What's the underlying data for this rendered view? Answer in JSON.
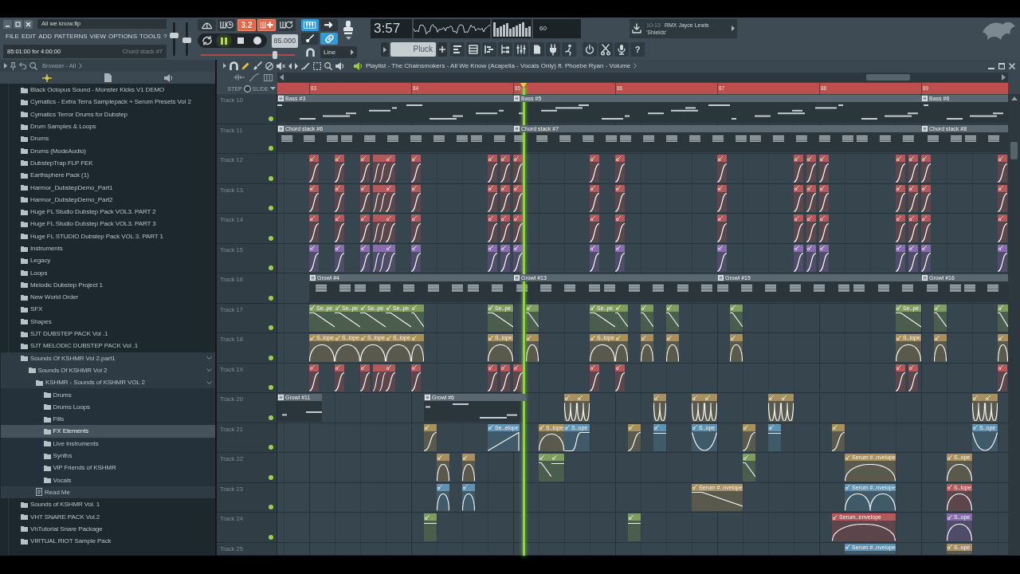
{
  "window": {
    "title": "All we know.flp",
    "menu": [
      "FILE",
      "EDIT",
      "ADD",
      "PATTERNS",
      "VIEW",
      "OPTIONS",
      "TOOLS",
      "?"
    ]
  },
  "hint_bar": {
    "position": "85:01:00 for 4:00:00",
    "clip": "Chord stack #7"
  },
  "master_sliders": [
    {
      "level": 0.62
    },
    {
      "level": 0.45
    }
  ],
  "transport": {
    "toggles": [
      {
        "kind": "metronome",
        "on": false
      },
      {
        "kind": "wait",
        "on": false
      },
      {
        "kind": "countdown",
        "label": "3.2",
        "on": true
      },
      {
        "kind": "step_edit",
        "on": true
      },
      {
        "kind": "loop_record",
        "on": false
      }
    ],
    "playing": true,
    "recording": false,
    "tempo": "85.000",
    "pitch": {
      "level": 0.8
    }
  },
  "snap": {
    "toggles": [
      {
        "kind": "keyboard",
        "on": true
      },
      {
        "kind": "arrow",
        "on": false
      },
      {
        "kind": "pen",
        "on": false
      },
      {
        "kind": "link",
        "on": true
      }
    ],
    "value": "Line"
  },
  "monitor": {
    "time": "3:57",
    "cpu": "60"
  },
  "pattern": {
    "name": "Pluck"
  },
  "help": "?",
  "hint_panel": {
    "tag": "10-13",
    "lines": [
      "RMX Jayce Lewis",
      "'Shields'"
    ]
  },
  "browser": {
    "title": "Browser - All",
    "items": [
      {
        "label": "Black Octopus Sound - Monster Kicks V1 DEMO",
        "kind": "folder",
        "expanded": false,
        "selected": false
      },
      {
        "label": "Cymatics - Extra Terra Samplepack + Serum Presets Vol 2",
        "kind": "folder",
        "expanded": false,
        "selected": false
      },
      {
        "label": "Cymatics Terror Drums for Dubstep",
        "kind": "folder",
        "expanded": false,
        "selected": false
      },
      {
        "label": "Drum Samples & Loops",
        "kind": "folder",
        "expanded": false,
        "selected": false
      },
      {
        "label": "Drums",
        "kind": "folder",
        "expanded": false,
        "selected": false
      },
      {
        "label": "Drums (ModeAudio)",
        "kind": "folder",
        "expanded": false,
        "selected": false
      },
      {
        "label": "DubstepTrap FLP FEK",
        "kind": "folder",
        "expanded": false,
        "selected": false
      },
      {
        "label": "Earthsphere Pack (1)",
        "kind": "folder",
        "expanded": false,
        "selected": false
      },
      {
        "label": "Harmor_DubstepDemo_Part1",
        "kind": "folder",
        "expanded": false,
        "selected": false
      },
      {
        "label": "Harmor_DubstepDemo_Part2",
        "kind": "folder",
        "expanded": false,
        "selected": false
      },
      {
        "label": "Huge FL Studio Dubstep Pack VOL3. PART 2",
        "kind": "folder",
        "expanded": false,
        "selected": false
      },
      {
        "label": "Huge FL Studio Dubstep Pack VOL3. PART 3",
        "kind": "folder",
        "expanded": false,
        "selected": false
      },
      {
        "label": "Huge FL STUDIO Dubstep Pack VOL 3. PART 1",
        "kind": "folder",
        "expanded": false,
        "selected": false
      },
      {
        "label": "Instruments",
        "kind": "folder",
        "expanded": false,
        "selected": false
      },
      {
        "label": "Legacy",
        "kind": "folder",
        "expanded": false,
        "selected": false
      },
      {
        "label": "Loops",
        "kind": "folder",
        "expanded": false,
        "selected": false
      },
      {
        "label": "Melodic Dubstep Project 1",
        "kind": "folder",
        "expanded": false,
        "selected": false
      },
      {
        "label": "New World Order",
        "kind": "folder",
        "expanded": false,
        "selected": false
      },
      {
        "label": "SFX",
        "kind": "folder",
        "expanded": false,
        "selected": false
      },
      {
        "label": "Shapes",
        "kind": "folder",
        "expanded": false,
        "selected": false
      },
      {
        "label": "SJT DUBSTEP PACK Vol .1",
        "kind": "folder",
        "expanded": false,
        "selected": false
      },
      {
        "label": "SJT MELODIC DUBSTEP PACK Vol .1",
        "kind": "folder",
        "expanded": false,
        "selected": false
      },
      {
        "label": "Sounds Of KSHMR Vol 2.part1",
        "kind": "folder",
        "expanded": true,
        "selected": false,
        "children": [
          {
            "label": "Sounds Of KSHMR Vol 2",
            "kind": "folder",
            "expanded": true,
            "selected": false,
            "children": [
              {
                "label": "KSHMR - Sounds of KSHMR VOL 2",
                "kind": "folder",
                "expanded": true,
                "selected": false,
                "children": [
                  {
                    "label": "Drums",
                    "kind": "folder",
                    "expanded": false,
                    "selected": false
                  },
                  {
                    "label": "Drums Loops",
                    "kind": "folder",
                    "expanded": false,
                    "selected": false
                  },
                  {
                    "label": "Fills",
                    "kind": "folder",
                    "expanded": false,
                    "selected": false
                  },
                  {
                    "label": "FX Elements",
                    "kind": "folder",
                    "expanded": false,
                    "selected": true
                  },
                  {
                    "label": "Live Instruments",
                    "kind": "folder",
                    "expanded": false,
                    "selected": false
                  },
                  {
                    "label": "Synths",
                    "kind": "folder",
                    "expanded": false,
                    "selected": false
                  },
                  {
                    "label": "ViP Friends of KSHMR",
                    "kind": "folder",
                    "expanded": false,
                    "selected": false
                  },
                  {
                    "label": "Vocals",
                    "kind": "folder",
                    "expanded": false,
                    "selected": false
                  }
                ]
              },
              {
                "label": "Read Me",
                "kind": "file",
                "expanded": false,
                "selected": false
              }
            ]
          }
        ]
      },
      {
        "label": "Sounds of KSHMR Vol. 1",
        "kind": "folder",
        "expanded": false,
        "selected": false
      },
      {
        "label": "VHT SNARE PACK Vol.2",
        "kind": "folder",
        "expanded": false,
        "selected": false
      },
      {
        "label": "VhTutorial Snare Package",
        "kind": "folder",
        "expanded": false,
        "selected": false
      },
      {
        "label": "VIRTUAL RIOT Sample Pack",
        "kind": "folder",
        "expanded": false,
        "selected": false
      }
    ]
  },
  "playlist": {
    "title": "Playlist - The Chainsmokers - All We Know (Acapella - Vocals Only) ft. Phoebe Ryan - Volume",
    "modes": [
      "STEP",
      "SLIDE"
    ],
    "ruler": [
      "83",
      "84",
      "85",
      "86",
      "87",
      "88",
      "89"
    ],
    "tracks": [
      {
        "label": "Track 10",
        "enabled": true,
        "clips": [
          {
            "kind": "pattern",
            "label": "Bass #3",
            "color": "#5a6770"
          },
          {
            "kind": "pattern",
            "label": "Bass #5",
            "color": "#5a6770"
          },
          {
            "kind": "pattern",
            "label": "Bass #6",
            "color": "#5a6770"
          }
        ]
      },
      {
        "label": "Track 11",
        "enabled": true,
        "clips": [
          {
            "kind": "pattern",
            "label": "Chord stack #6",
            "color": "#5a6770"
          },
          {
            "kind": "pattern",
            "label": "Chord stack #7",
            "color": "#5a6770"
          },
          {
            "kind": "pattern",
            "label": "Chord stack #8",
            "color": "#5a6770"
          }
        ]
      },
      {
        "label": "Track 12",
        "enabled": true,
        "clips": [
          {
            "kind": "rise",
            "color": "#b4585a"
          },
          {
            "kind": "rise",
            "color": "#b4585a"
          },
          {
            "kind": "rise",
            "color": "#b4585a"
          },
          {
            "kind": "rise",
            "color": "#b4585a"
          },
          {
            "kind": "rise",
            "color": "#b4585a"
          },
          {
            "kind": "rise",
            "color": "#b4585a"
          },
          {
            "kind": "rise",
            "color": "#b4585a"
          },
          {
            "kind": "rise",
            "color": "#b4585a"
          },
          {
            "kind": "rise",
            "color": "#b4585a"
          },
          {
            "kind": "rise",
            "color": "#b4585a"
          },
          {
            "kind": "rise",
            "color": "#b4585a"
          },
          {
            "kind": "rise",
            "color": "#b4585a"
          },
          {
            "kind": "rise",
            "color": "#b4585a"
          },
          {
            "kind": "rise",
            "color": "#b4585a"
          },
          {
            "kind": "rise",
            "color": "#b4585a"
          },
          {
            "kind": "rise",
            "color": "#b4585a"
          },
          {
            "kind": "rise",
            "color": "#b4585a"
          },
          {
            "kind": "rise",
            "color": "#b4585a"
          },
          {
            "kind": "rise",
            "color": "#b4585a"
          },
          {
            "kind": "rise",
            "color": "#b4585a"
          }
        ]
      },
      {
        "label": "Track 13",
        "enabled": true,
        "clips": [
          {
            "kind": "rise",
            "color": "#b4585a"
          },
          {
            "kind": "rise",
            "color": "#b4585a"
          },
          {
            "kind": "rise",
            "color": "#b4585a"
          },
          {
            "kind": "rise",
            "color": "#b4585a"
          },
          {
            "kind": "rise",
            "color": "#b4585a"
          },
          {
            "kind": "rise",
            "color": "#b4585a"
          },
          {
            "kind": "rise",
            "color": "#b4585a"
          },
          {
            "kind": "rise",
            "color": "#b4585a"
          },
          {
            "kind": "rise",
            "color": "#b4585a"
          },
          {
            "kind": "rise",
            "color": "#b4585a"
          },
          {
            "kind": "rise",
            "color": "#b4585a"
          },
          {
            "kind": "rise",
            "color": "#b4585a"
          },
          {
            "kind": "rise",
            "color": "#b4585a"
          },
          {
            "kind": "rise",
            "color": "#b4585a"
          },
          {
            "kind": "rise",
            "color": "#b4585a"
          },
          {
            "kind": "rise",
            "color": "#b4585a"
          },
          {
            "kind": "rise",
            "color": "#b4585a"
          },
          {
            "kind": "rise",
            "color": "#b4585a"
          },
          {
            "kind": "rise",
            "color": "#b4585a"
          },
          {
            "kind": "rise",
            "color": "#b4585a"
          }
        ]
      },
      {
        "label": "Track 14",
        "enabled": true,
        "clips": [
          {
            "kind": "rise",
            "color": "#b4585a"
          },
          {
            "kind": "rise",
            "color": "#b4585a"
          },
          {
            "kind": "rise",
            "color": "#b4585a"
          },
          {
            "kind": "rise",
            "color": "#b4585a"
          },
          {
            "kind": "rise",
            "color": "#b4585a"
          },
          {
            "kind": "rise",
            "color": "#b4585a"
          },
          {
            "kind": "rise",
            "color": "#b4585a"
          },
          {
            "kind": "rise",
            "color": "#b4585a"
          },
          {
            "kind": "rise",
            "color": "#b4585a"
          },
          {
            "kind": "rise",
            "color": "#b4585a"
          },
          {
            "kind": "rise",
            "color": "#b4585a"
          },
          {
            "kind": "rise",
            "color": "#b4585a"
          },
          {
            "kind": "rise",
            "color": "#b4585a"
          },
          {
            "kind": "rise",
            "color": "#b4585a"
          },
          {
            "kind": "rise",
            "color": "#b4585a"
          },
          {
            "kind": "rise",
            "color": "#b4585a"
          },
          {
            "kind": "rise",
            "color": "#b4585a"
          },
          {
            "kind": "rise",
            "color": "#b4585a"
          },
          {
            "kind": "rise",
            "color": "#b4585a"
          },
          {
            "kind": "rise",
            "color": "#b4585a"
          }
        ]
      },
      {
        "label": "Track 15",
        "enabled": true,
        "clips": [
          {
            "kind": "rise",
            "color": "#8a6cb0"
          },
          {
            "kind": "rise",
            "color": "#8a6cb0"
          },
          {
            "kind": "rise",
            "color": "#8a6cb0"
          },
          {
            "kind": "rise",
            "color": "#8a6cb0"
          },
          {
            "kind": "rise",
            "color": "#8a6cb0"
          },
          {
            "kind": "rise",
            "color": "#8a6cb0"
          },
          {
            "kind": "rise",
            "color": "#8a6cb0"
          },
          {
            "kind": "rise",
            "color": "#8a6cb0"
          },
          {
            "kind": "rise",
            "color": "#8a6cb0"
          },
          {
            "kind": "rise",
            "color": "#8a6cb0"
          },
          {
            "kind": "rise",
            "color": "#8a6cb0"
          },
          {
            "kind": "rise",
            "color": "#8a6cb0"
          },
          {
            "kind": "rise",
            "color": "#8a6cb0"
          },
          {
            "kind": "rise",
            "color": "#8a6cb0"
          },
          {
            "kind": "rise",
            "color": "#8a6cb0"
          },
          {
            "kind": "rise",
            "color": "#8a6cb0"
          },
          {
            "kind": "rise",
            "color": "#8a6cb0"
          },
          {
            "kind": "rise",
            "color": "#8a6cb0"
          },
          {
            "kind": "rise",
            "color": "#8a6cb0"
          },
          {
            "kind": "rise",
            "color": "#8a6cb0"
          }
        ]
      },
      {
        "label": "Track 16",
        "enabled": true,
        "clips": [
          {
            "kind": "pattern",
            "label": "Growl #4",
            "color": "#5a6770"
          },
          {
            "kind": "pattern",
            "label": "Growl #13",
            "color": "#5a6770"
          },
          {
            "kind": "pattern",
            "label": "Growl #15",
            "color": "#5a6770"
          },
          {
            "kind": "pattern",
            "label": "Growl #16",
            "color": "#5a6770"
          }
        ]
      },
      {
        "label": "Track 17",
        "enabled": true,
        "clips": [
          {
            "kind": "fall",
            "label": "Se..pe",
            "color": "#7f9d5c"
          },
          {
            "kind": "fall",
            "label": "Se..pe",
            "color": "#7f9d5c"
          },
          {
            "kind": "fall",
            "label": "Se..pe",
            "color": "#7f9d5c"
          },
          {
            "kind": "fall",
            "label": "Se..pe",
            "color": "#7f9d5c"
          },
          {
            "kind": "fall",
            "color": "#7f9d5c"
          },
          {
            "kind": "fall",
            "label": "Se..pe",
            "color": "#7f9d5c"
          },
          {
            "kind": "fall",
            "color": "#7f9d5c"
          },
          {
            "kind": "fall",
            "label": "Se..pe",
            "color": "#7f9d5c"
          },
          {
            "kind": "fall",
            "color": "#7f9d5c"
          },
          {
            "kind": "fall",
            "color": "#7f9d5c"
          },
          {
            "kind": "fall",
            "color": "#7f9d5c"
          },
          {
            "kind": "fall",
            "color": "#7f9d5c"
          },
          {
            "kind": "fall",
            "label": "Se..pe",
            "color": "#7f9d5c"
          },
          {
            "kind": "fall",
            "color": "#7f9d5c"
          },
          {
            "kind": "fall",
            "color": "#7f9d5c"
          }
        ]
      },
      {
        "label": "Track 18",
        "enabled": true,
        "clips": [
          {
            "kind": "arch",
            "label": "S..lope",
            "color": "#a8905e"
          },
          {
            "kind": "arch",
            "label": "S..lope",
            "color": "#a8905e"
          },
          {
            "kind": "arch",
            "label": "S..lope",
            "color": "#a8905e"
          },
          {
            "kind": "arch",
            "label": "S..lope",
            "color": "#a8905e"
          },
          {
            "kind": "arch",
            "color": "#a8905e"
          },
          {
            "kind": "arch",
            "label": "S..lope",
            "color": "#a8905e"
          },
          {
            "kind": "arch",
            "color": "#a8905e"
          },
          {
            "kind": "arch",
            "label": "S..lope",
            "color": "#a8905e"
          },
          {
            "kind": "arch",
            "color": "#a8905e"
          },
          {
            "kind": "arch",
            "color": "#a8905e"
          },
          {
            "kind": "arch",
            "color": "#a8905e"
          },
          {
            "kind": "arch",
            "color": "#a8905e"
          },
          {
            "kind": "arch",
            "label": "S..lope",
            "color": "#a8905e"
          },
          {
            "kind": "arch",
            "color": "#a8905e"
          },
          {
            "kind": "arch",
            "color": "#a8905e"
          }
        ]
      },
      {
        "label": "Track 19",
        "enabled": true,
        "clips": [
          {
            "kind": "rise",
            "color": "#b4585a"
          },
          {
            "kind": "rise",
            "color": "#b4585a"
          },
          {
            "kind": "rise",
            "color": "#b4585a"
          },
          {
            "kind": "rise",
            "color": "#b4585a"
          },
          {
            "kind": "rise",
            "color": "#b4585a"
          },
          {
            "kind": "rise",
            "color": "#b4585a"
          },
          {
            "kind": "rise",
            "color": "#b4585a"
          },
          {
            "kind": "rise",
            "color": "#b4585a"
          },
          {
            "kind": "rise",
            "color": "#b4585a"
          },
          {
            "kind": "rise",
            "color": "#b4585a"
          },
          {
            "kind": "rise",
            "color": "#b4585a"
          },
          {
            "kind": "rise",
            "color": "#b4585a"
          },
          {
            "kind": "rise",
            "color": "#b4585a"
          },
          {
            "kind": "rise",
            "color": "#b4585a"
          },
          {
            "kind": "rise",
            "color": "#b4585a"
          }
        ]
      },
      {
        "label": "Track 20",
        "enabled": true,
        "clips": [
          {
            "kind": "pattern",
            "label": "Growl #11",
            "color": "#5a6770"
          },
          {
            "kind": "pattern",
            "label": "Growl #6",
            "color": "#5a6770"
          },
          {
            "kind": "bounce",
            "color": "#a8905e"
          },
          {
            "kind": "bounce",
            "color": "#a8905e"
          },
          {
            "kind": "bounce",
            "color": "#a8905e"
          },
          {
            "kind": "bounce",
            "color": "#a8905e"
          },
          {
            "kind": "bounce",
            "color": "#a8905e"
          },
          {
            "kind": "bounce",
            "color": "#a8905e"
          },
          {
            "kind": "bounce",
            "color": "#a8905e"
          },
          {
            "kind": "bounce",
            "color": "#a8905e"
          },
          {
            "kind": "bounce",
            "color": "#a8905e"
          }
        ]
      },
      {
        "label": "Track 21",
        "enabled": true,
        "clips": [
          {
            "kind": "rise",
            "color": "#a8905e"
          },
          {
            "kind": "ramp",
            "label": "Se..elope",
            "color": "#5f93b3"
          },
          {
            "kind": "arch",
            "label": "S..lope",
            "color": "#a8905e"
          },
          {
            "kind": "stepup",
            "label": "S..ope",
            "color": "#5f93b3"
          },
          {
            "kind": "rise",
            "color": "#a8905e"
          },
          {
            "kind": "flat",
            "color": "#5f93b3"
          },
          {
            "kind": "dip",
            "label": "S..ope",
            "color": "#5f93b3"
          },
          {
            "kind": "rise",
            "color": "#a8905e"
          },
          {
            "kind": "flat",
            "color": "#5f93b3"
          },
          {
            "kind": "rise",
            "color": "#a8905e"
          },
          {
            "kind": "dip",
            "label": "S..ope",
            "color": "#5f93b3"
          }
        ]
      },
      {
        "label": "Track 22",
        "enabled": true,
        "clips": [
          {
            "kind": "arch",
            "color": "#a8905e"
          },
          {
            "kind": "arch",
            "color": "#a8905e"
          },
          {
            "kind": "fall",
            "color": "#7f9d5c"
          },
          {
            "kind": "flat",
            "color": "#7f9d5c"
          },
          {
            "kind": "fall",
            "color": "#7f9d5c"
          },
          {
            "kind": "arch",
            "label": "Serum #..nvelope",
            "color": "#a8905e"
          },
          {
            "kind": "arch",
            "label": "S..ope",
            "color": "#a8905e"
          }
        ]
      },
      {
        "label": "Track 23",
        "enabled": true,
        "clips": [
          {
            "kind": "arch",
            "color": "#5f93b3"
          },
          {
            "kind": "arch",
            "color": "#5f93b3"
          },
          {
            "kind": "fall",
            "label": "Serum #..nvelope",
            "color": "#a8905e"
          },
          {
            "kind": "doublearch",
            "label": "Serum #..nvelope",
            "color": "#5f93b3"
          },
          {
            "kind": "arch",
            "label": "S..lope",
            "color": "#b4585a"
          }
        ]
      },
      {
        "label": "Track 24",
        "enabled": true,
        "clips": [
          {
            "kind": "flat",
            "color": "#7f9d5c"
          },
          {
            "kind": "flat",
            "color": "#7f9d5c"
          },
          {
            "kind": "arch",
            "label": "Serum..envelope",
            "color": "#b4585a"
          },
          {
            "kind": "arch",
            "label": "S..ope",
            "color": "#8a6cb0"
          }
        ]
      },
      {
        "label": "Track 25",
        "clips": [
          {
            "kind": "automation",
            "label": "Serum #..nvelope",
            "color": "#5f93b3"
          },
          {
            "kind": "automation",
            "label": "S..ope",
            "color": "#a8905e"
          }
        ]
      }
    ]
  }
}
